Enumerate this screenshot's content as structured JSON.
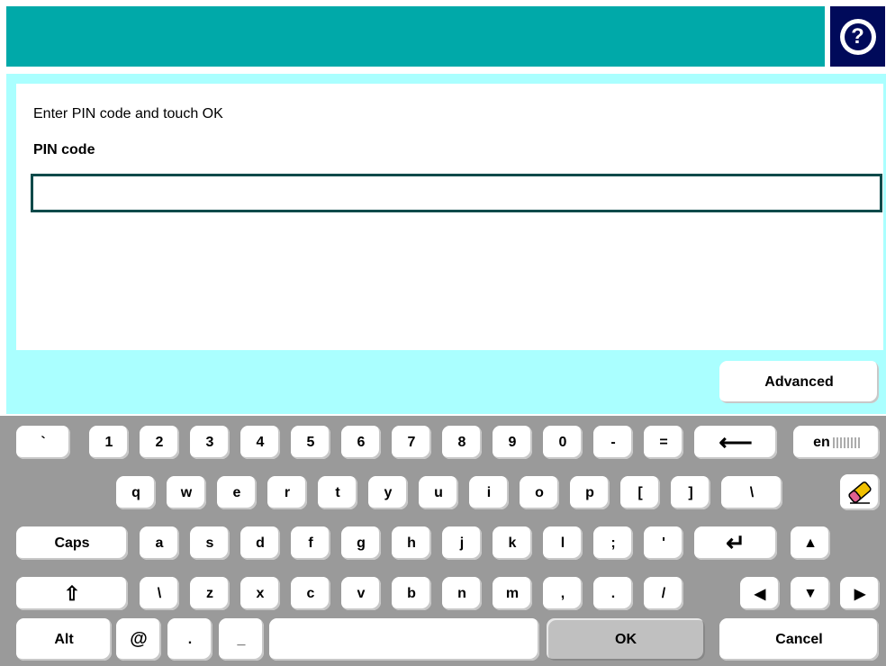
{
  "header": {
    "help_label": "?"
  },
  "form": {
    "prompt": "Enter PIN code and touch OK",
    "pin_label": "PIN code",
    "pin_value": ""
  },
  "advanced_label": "Advanced",
  "keyboard": {
    "row1": [
      "`",
      "1",
      "2",
      "3",
      "4",
      "5",
      "6",
      "7",
      "8",
      "9",
      "0",
      "-",
      "="
    ],
    "backspace_label": "⟵",
    "lang_label": "en",
    "row2": [
      "q",
      "w",
      "e",
      "r",
      "t",
      "y",
      "u",
      "i",
      "o",
      "p",
      "[",
      "]",
      "\\"
    ],
    "caps_label": "Caps",
    "row3": [
      "a",
      "s",
      "d",
      "f",
      "g",
      "h",
      "j",
      "k",
      "l",
      ";",
      "'"
    ],
    "enter_label": "↵",
    "up_label": "▲",
    "shift_label": "⇧",
    "row4": [
      "\\",
      "z",
      "x",
      "c",
      "v",
      "b",
      "n",
      "m",
      ",",
      ".",
      "/"
    ],
    "left_label": "◀",
    "down_label": "▼",
    "right_label": "▶",
    "alt_label": "Alt",
    "row5": [
      "@",
      ".",
      "_"
    ],
    "space_label": "",
    "ok_label": "OK",
    "cancel_label": "Cancel"
  },
  "icons": {
    "help": "help-icon",
    "eraser": "eraser-icon"
  },
  "colors": {
    "header": "#00a9a9",
    "panel": "#aaffff",
    "keyboard_bg": "#9a9a9a",
    "help_bg": "#000a5a"
  }
}
